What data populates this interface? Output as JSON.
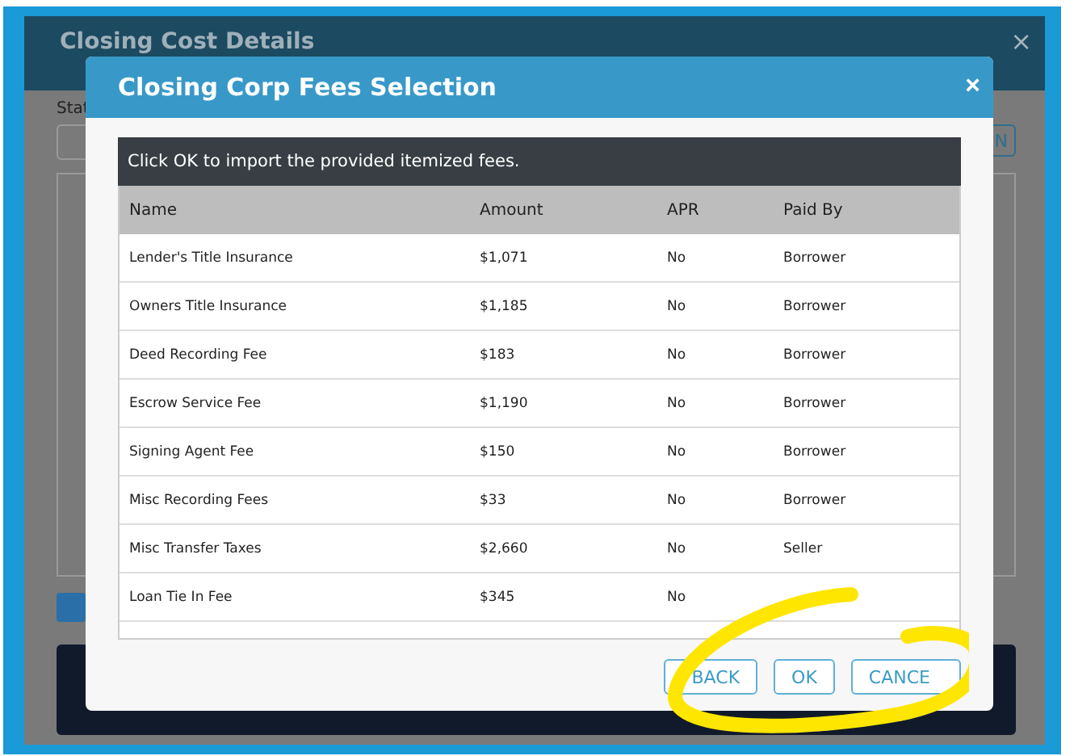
{
  "background_dialog": {
    "title": "Closing Cost Details",
    "close": "×",
    "field_label": "Stat",
    "side_button": "N"
  },
  "modal": {
    "title": "Closing Corp Fees Selection",
    "close": "×",
    "notice": "Click OK to import the provided itemized fees.",
    "table": {
      "columns": [
        "Name",
        "Amount",
        "APR",
        "Paid By"
      ],
      "rows": [
        {
          "name": "Lender's Title Insurance",
          "amount": "$1,071",
          "apr": "No",
          "paid_by": "Borrower"
        },
        {
          "name": "Owners Title Insurance",
          "amount": "$1,185",
          "apr": "No",
          "paid_by": "Borrower"
        },
        {
          "name": "Deed Recording Fee",
          "amount": "$183",
          "apr": "No",
          "paid_by": "Borrower"
        },
        {
          "name": "Escrow Service Fee",
          "amount": "$1,190",
          "apr": "No",
          "paid_by": "Borrower"
        },
        {
          "name": "Signing Agent Fee",
          "amount": "$150",
          "apr": "No",
          "paid_by": "Borrower"
        },
        {
          "name": "Misc Recording Fees",
          "amount": "$33",
          "apr": "No",
          "paid_by": "Borrower"
        },
        {
          "name": "Misc Transfer Taxes",
          "amount": "$2,660",
          "apr": "No",
          "paid_by": "Seller"
        },
        {
          "name": "Loan Tie In Fee",
          "amount": "$345",
          "apr": "No"
        }
      ]
    },
    "buttons": [
      "BACK",
      "OK",
      "CANCE"
    ]
  }
}
